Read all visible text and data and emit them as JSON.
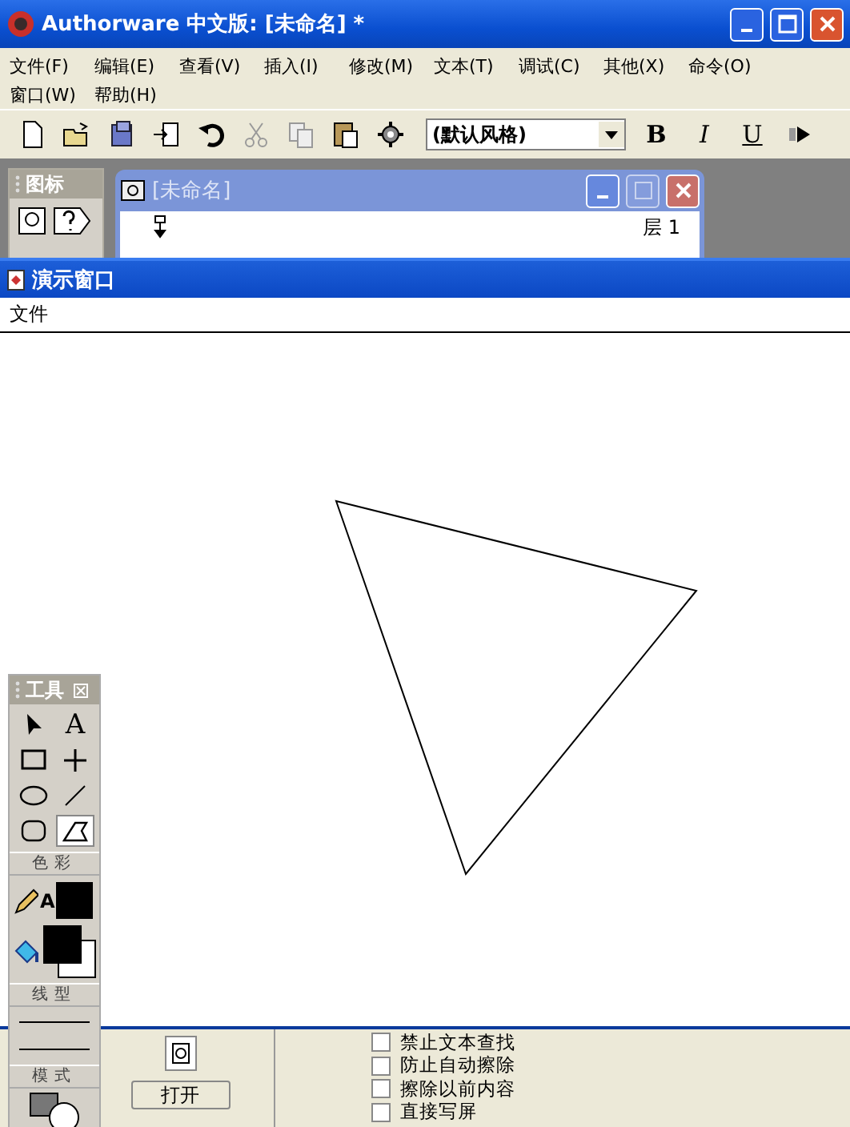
{
  "app_window": {
    "title": "Authorware 中文版: [未命名] *"
  },
  "menu": [
    "文件(F)",
    "编辑(E)",
    "查看(V)",
    "插入(I)",
    "修改(M)",
    "文本(T)",
    "调试(C)",
    "其他(X)",
    "命令(O)",
    "窗口(W)",
    "帮助(H)"
  ],
  "toolbar": {
    "style_dropdown": {
      "value": "(默认风格)"
    },
    "format_buttons": [
      {
        "label": "B",
        "kind": "bold"
      },
      {
        "label": "I",
        "kind": "italic"
      },
      {
        "label": "U",
        "kind": "underline"
      }
    ]
  },
  "icon_palette": {
    "title": "图标"
  },
  "flowline_window": {
    "title": "[未命名]",
    "layer_label": "层 1"
  },
  "presentation_window": {
    "title": "演示窗口",
    "menu": [
      "文件"
    ]
  },
  "tools_palette": {
    "title": "工具",
    "tools": [
      {
        "kind": "pointer",
        "selected": false
      },
      {
        "kind": "text",
        "glyph": "A",
        "selected": false
      },
      {
        "kind": "rectangle",
        "selected": false
      },
      {
        "kind": "straight-line",
        "selected": false
      },
      {
        "kind": "ellipse",
        "selected": false
      },
      {
        "kind": "diagonal-line",
        "selected": false
      },
      {
        "kind": "rounded-rectangle",
        "selected": false
      },
      {
        "kind": "polygon",
        "selected": true
      }
    ],
    "color_section": "色彩",
    "line_color_glyph": "A",
    "line_section": "线型",
    "mode_section": "模式"
  },
  "properties_panel": {
    "open_button": "打开",
    "options": [
      {
        "label": "禁止文本查找",
        "checked": false
      },
      {
        "label": "防止自动擦除",
        "checked": false
      },
      {
        "label": "擦除以前内容",
        "checked": false
      },
      {
        "label": "直接写屏",
        "checked": false
      }
    ]
  }
}
